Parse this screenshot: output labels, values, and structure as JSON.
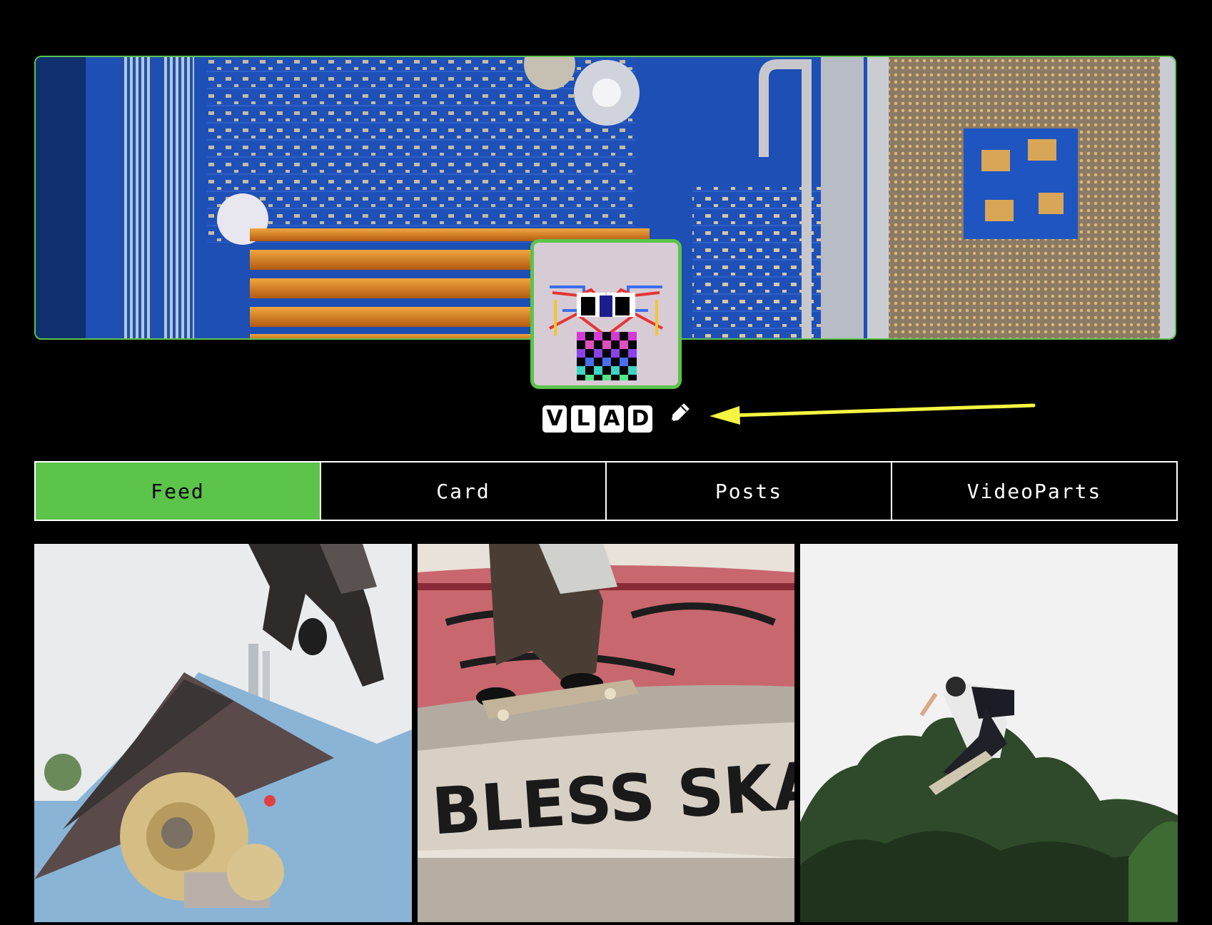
{
  "profile": {
    "name_letters": [
      "V",
      "L",
      "A",
      "D"
    ],
    "edit_icon": "pencil-icon"
  },
  "annotation": {
    "arrow_color": "#f5f542"
  },
  "tabs": [
    {
      "label": "Feed",
      "active": true
    },
    {
      "label": "Card",
      "active": false
    },
    {
      "label": "Posts",
      "active": false
    },
    {
      "label": "VideoParts",
      "active": false
    }
  ],
  "feed": {
    "items": [
      {
        "alt": "skateboard-wheel-closeup"
      },
      {
        "alt": "skater-grind-graffiti-wall"
      },
      {
        "alt": "skater-air-trees"
      }
    ]
  },
  "colors": {
    "accent": "#5cc44a",
    "background": "#000000"
  }
}
